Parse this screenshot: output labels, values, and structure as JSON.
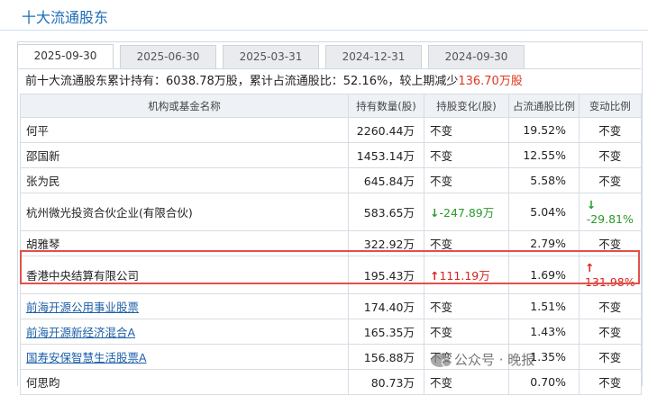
{
  "header": {
    "title": "十大流通股东"
  },
  "tabs": [
    "2025-09-30",
    "2025-06-30",
    "2025-03-31",
    "2024-12-31",
    "2024-09-30"
  ],
  "summary": {
    "prefix": "前十大流通股东累计持有：6038.78万股，累计占流通股比：52.16%，较上期减少",
    "change": "136.70万股"
  },
  "table": {
    "columns": [
      "机构或基金名称",
      "持有数量(股)",
      "持股变化(股)",
      "占流通股比例",
      "变动比例"
    ],
    "rows": [
      {
        "name": "何平",
        "link": false,
        "shares": "2260.44万",
        "change": "不变",
        "change_dir": "",
        "pct": "19.52%",
        "ratio": "不变",
        "ratio_dir": ""
      },
      {
        "name": "邵国新",
        "link": false,
        "shares": "1453.14万",
        "change": "不变",
        "change_dir": "",
        "pct": "12.55%",
        "ratio": "不变",
        "ratio_dir": ""
      },
      {
        "name": "张为民",
        "link": false,
        "shares": "645.84万",
        "change": "不变",
        "change_dir": "",
        "pct": "5.58%",
        "ratio": "不变",
        "ratio_dir": ""
      },
      {
        "name": "杭州微光投资合伙企业(有限合伙)",
        "link": false,
        "shares": "583.65万",
        "change": "-247.89万",
        "change_dir": "down",
        "pct": "5.04%",
        "ratio": "-29.81%",
        "ratio_dir": "down"
      },
      {
        "name": "胡雅琴",
        "link": false,
        "shares": "322.92万",
        "change": "不变",
        "change_dir": "",
        "pct": "2.79%",
        "ratio": "不变",
        "ratio_dir": ""
      },
      {
        "name": "香港中央结算有限公司",
        "link": false,
        "shares": "195.43万",
        "change": "111.19万",
        "change_dir": "up",
        "pct": "1.69%",
        "ratio": "131.98%",
        "ratio_dir": "up"
      },
      {
        "name": "前海开源公用事业股票",
        "link": true,
        "shares": "174.40万",
        "change": "不变",
        "change_dir": "",
        "pct": "1.51%",
        "ratio": "不变",
        "ratio_dir": ""
      },
      {
        "name": "前海开源新经济混合A",
        "link": true,
        "shares": "165.35万",
        "change": "不变",
        "change_dir": "",
        "pct": "1.43%",
        "ratio": "不变",
        "ratio_dir": ""
      },
      {
        "name": "国寿安保智慧生活股票A",
        "link": true,
        "shares": "156.88万",
        "change": "不变",
        "change_dir": "",
        "pct": "1.35%",
        "ratio": "不变",
        "ratio_dir": ""
      },
      {
        "name": "何思昀",
        "link": false,
        "shares": "80.73万",
        "change": "不变",
        "change_dir": "",
        "pct": "0.70%",
        "ratio": "不变",
        "ratio_dir": ""
      }
    ]
  },
  "watermark": {
    "text": "公众号 · 晚报"
  },
  "colors": {
    "accent": "#1c6db8",
    "up": "#d8221a",
    "down": "#2a9a2a",
    "highlight": "#e2504a"
  }
}
